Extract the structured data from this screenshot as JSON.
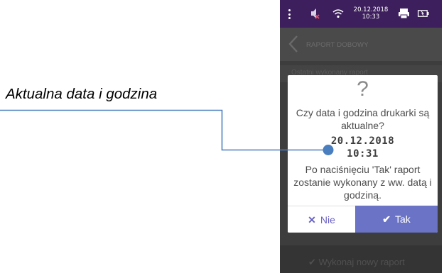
{
  "callout": {
    "label": "Aktualna data i godzina"
  },
  "status_bar": {
    "date": "20.12.2018",
    "time": "10:33",
    "icons": [
      "menu-dots-icon",
      "volume-muted-icon",
      "wifi-icon",
      "printer-icon",
      "battery-icon"
    ]
  },
  "app_bar": {
    "title": "RAPORT DOBOWY"
  },
  "background": {
    "row_text": "Ostatni wykonany raport",
    "bottom_button": "Wykonaj nowy raport"
  },
  "dialog": {
    "icon": "?",
    "question": "Czy data i godzina drukarki są aktualne?",
    "date": "20.12.2018",
    "time": "10:31",
    "note": "Po naciśnięciu 'Tak' raport zostanie wykonany z ww. datą i godziną.",
    "buttons": {
      "cancel": "Nie",
      "confirm": "Tak"
    }
  },
  "colors": {
    "status_bar": "#3c1f5c",
    "confirm_button": "#6a73c6",
    "cancel_text": "#6a62c2",
    "callout_line": "#4a7fbf"
  }
}
